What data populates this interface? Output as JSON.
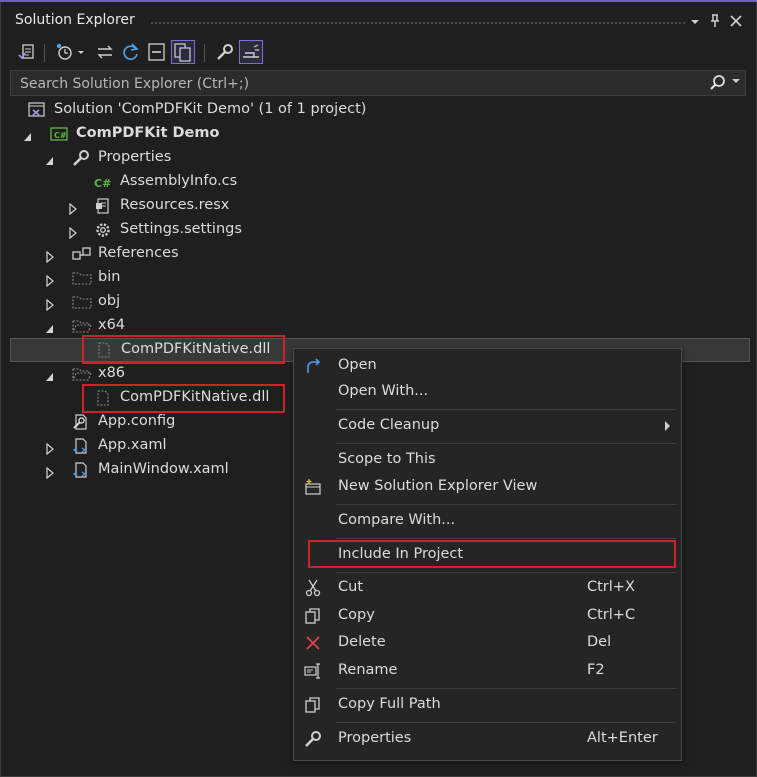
{
  "panel": {
    "title": "Solution Explorer",
    "pin_glyph": "▾",
    "autohide_glyph": "📌",
    "close_glyph": "✕"
  },
  "search": {
    "placeholder": "Search Solution Explorer (Ctrl+;)"
  },
  "tree": {
    "solution": "Solution 'ComPDFKit Demo' (1 of 1 project)",
    "project": "ComPDFKit Demo",
    "properties": "Properties",
    "assemblyinfo": "AssemblyInfo.cs",
    "resources": "Resources.resx",
    "settings": "Settings.settings",
    "references": "References",
    "bin": "bin",
    "obj": "obj",
    "x64": "x64",
    "x64_dll": "ComPDFKitNative.dll",
    "x86": "x86",
    "x86_dll": "ComPDFKitNative.dll",
    "appconfig": "App.config",
    "appxaml": "App.xaml",
    "mainwindow": "MainWindow.xaml"
  },
  "menu": {
    "open": "Open",
    "open_with": "Open With...",
    "code_cleanup": "Code Cleanup",
    "scope_to_this": "Scope to This",
    "new_view": "New Solution Explorer View",
    "compare_with": "Compare With...",
    "include_in_project": "Include In Project",
    "cut": "Cut",
    "cut_sc": "Ctrl+X",
    "copy": "Copy",
    "copy_sc": "Ctrl+C",
    "delete": "Delete",
    "delete_sc": "Del",
    "rename": "Rename",
    "rename_sc": "F2",
    "copy_full_path": "Copy Full Path",
    "properties": "Properties",
    "properties_sc": "Alt+Enter"
  },
  "colors": {
    "accent": "#6b5bd6",
    "highlight_box": "#d0202a",
    "background": "#1f1f1f"
  }
}
